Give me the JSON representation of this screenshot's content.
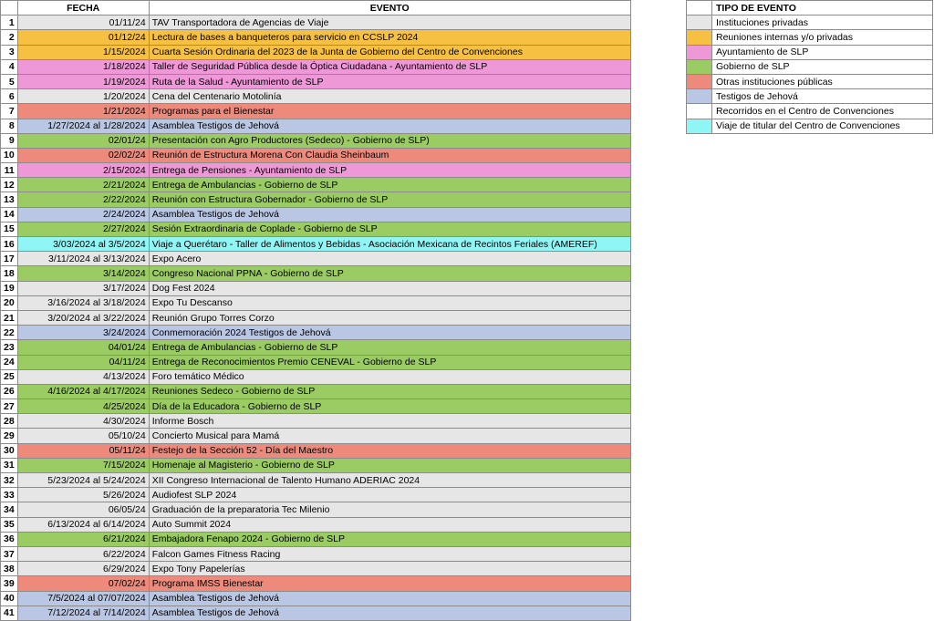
{
  "headers": {
    "fecha": "FECHA",
    "evento": "EVENTO",
    "tipo": "TIPO DE EVENTO"
  },
  "colors": {
    "privadas": "#e6e6e6",
    "internas": "#f6c142",
    "ayuntamiento": "#ef98d7",
    "gobierno": "#9bcc64",
    "otras": "#ee8a7c",
    "testigos": "#b9c6e4",
    "recorridos": "#ffffff",
    "viaje": "#8ff5f5"
  },
  "legend": [
    {
      "label": "Instituciones privadas",
      "type": "privadas"
    },
    {
      "label": "Reuniones internas y/o privadas",
      "type": "internas"
    },
    {
      "label": "Ayuntamiento de SLP",
      "type": "ayuntamiento"
    },
    {
      "label": "Gobierno de SLP",
      "type": "gobierno"
    },
    {
      "label": "Otras instituciones públicas",
      "type": "otras"
    },
    {
      "label": "Testigos de Jehová",
      "type": "testigos"
    },
    {
      "label": "Recorridos en el Centro de Convenciones",
      "type": "recorridos"
    },
    {
      "label": "Viaje de titular del Centro de Convenciones",
      "type": "viaje"
    }
  ],
  "rows": [
    {
      "num": "1",
      "fecha": "01/11/24",
      "evento": "TAV Transportadora de Agencias de Viaje",
      "type": "privadas"
    },
    {
      "num": "2",
      "fecha": "01/12/24",
      "evento": "Lectura de bases a banqueteros para servicio en CCSLP 2024",
      "type": "internas"
    },
    {
      "num": "3",
      "fecha": "1/15/2024",
      "evento": " Cuarta Sesión Ordinaria del 2023 de la Junta de Gobierno del Centro de Convenciones",
      "type": "internas"
    },
    {
      "num": "4",
      "fecha": "1/18/2024",
      "evento": "Taller de Seguridad Pública desde la Óptica Ciudadana - Ayuntamiento de SLP",
      "type": "ayuntamiento"
    },
    {
      "num": "5",
      "fecha": "1/19/2024",
      "evento": "Ruta de la Salud - Ayuntamiento de SLP",
      "type": "ayuntamiento"
    },
    {
      "num": "6",
      "fecha": "1/20/2024",
      "evento": "Cena del Centenario Motolinía",
      "type": "privadas"
    },
    {
      "num": "7",
      "fecha": "1/21/2024",
      "evento": "Programas para el Bienestar",
      "type": "otras"
    },
    {
      "num": "8",
      "fecha": "1/27/2024 al 1/28/2024",
      "evento": "Asamblea Testigos de Jehová",
      "type": "testigos"
    },
    {
      "num": "9",
      "fecha": "02/01/24",
      "evento": "Presentación con Agro Productores (Sedeco) - Gobierno de SLP)",
      "type": "gobierno"
    },
    {
      "num": "10",
      "fecha": "02/02/24",
      "evento": "Reunión de Estructura Morena Con Claudia Sheinbaum",
      "type": "otras"
    },
    {
      "num": "11",
      "fecha": "2/15/2024",
      "evento": "Entrega de Pensiones - Ayuntamiento de SLP",
      "type": "ayuntamiento"
    },
    {
      "num": "12",
      "fecha": "2/21/2024",
      "evento": "Entrega de Ambulancias - Gobierno de SLP",
      "type": "gobierno"
    },
    {
      "num": "13",
      "fecha": "2/22/2024",
      "evento": "Reunión con Estructura Gobernador - Gobierno de SLP",
      "type": "gobierno"
    },
    {
      "num": "14",
      "fecha": "2/24/2024",
      "evento": "Asamblea Testigos de Jehová",
      "type": "testigos"
    },
    {
      "num": "15",
      "fecha": "2/27/2024",
      "evento": "Sesión Extraordinaria de Coplade - Gobierno de SLP",
      "type": "gobierno"
    },
    {
      "num": "16",
      "fecha": "3/03/2024 al 3/5/2024",
      "evento": "Viaje a Querétaro - Taller de Alimentos y Bebidas - Asociación Mexicana de Recintos Feriales (AMEREF)",
      "type": "viaje"
    },
    {
      "num": "17",
      "fecha": "3/11/2024 al 3/13/2024",
      "evento": "Expo Acero",
      "type": "privadas"
    },
    {
      "num": "18",
      "fecha": "3/14/2024",
      "evento": "Congreso Nacional PPNA - Gobierno de SLP",
      "type": "gobierno"
    },
    {
      "num": "19",
      "fecha": "3/17/2024",
      "evento": "Dog Fest 2024",
      "type": "privadas"
    },
    {
      "num": "20",
      "fecha": "3/16/2024 al 3/18/2024",
      "evento": "Expo Tu Descanso",
      "type": "privadas"
    },
    {
      "num": "21",
      "fecha": "3/20/2024 al 3/22/2024",
      "evento": "Reunión Grupo Torres Corzo",
      "type": "privadas"
    },
    {
      "num": "22",
      "fecha": "3/24/2024",
      "evento": "Conmemoración 2024 Testigos de Jehová",
      "type": "testigos"
    },
    {
      "num": "23",
      "fecha": "04/01/24",
      "evento": "Entrega de Ambulancias - Gobierno de SLP",
      "type": "gobierno"
    },
    {
      "num": "24",
      "fecha": "04/11/24",
      "evento": "Entrega de Reconocimientos Premio CENEVAL - Gobierno de SLP",
      "type": "gobierno"
    },
    {
      "num": "25",
      "fecha": "4/13/2024",
      "evento": "Foro temático Médico",
      "type": "privadas"
    },
    {
      "num": "26",
      "fecha": "4/16/2024 al 4/17/2024",
      "evento": "Reuniones Sedeco - Gobierno de SLP",
      "type": "gobierno"
    },
    {
      "num": "27",
      "fecha": "4/25/2024",
      "evento": "Día de la Educadora - Gobierno de SLP",
      "type": "gobierno"
    },
    {
      "num": "28",
      "fecha": "4/30/2024",
      "evento": "Informe Bosch",
      "type": "privadas"
    },
    {
      "num": "29",
      "fecha": "05/10/24",
      "evento": "Concierto Musical para Mamá",
      "type": "privadas"
    },
    {
      "num": "30",
      "fecha": "05/11/24",
      "evento": "Festejo de la Sección 52 - Día del Maestro",
      "type": "otras"
    },
    {
      "num": "31",
      "fecha": "7/15/2024",
      "evento": "Homenaje al Magisterio - Gobierno de SLP",
      "type": "gobierno"
    },
    {
      "num": "32",
      "fecha": "5/23/2024 al 5/24/2024",
      "evento": "XII Congreso Internacional de Talento Humano ADERIAC 2024",
      "type": "privadas"
    },
    {
      "num": "33",
      "fecha": "5/26/2024",
      "evento": "Audiofest SLP 2024",
      "type": "privadas"
    },
    {
      "num": "34",
      "fecha": "06/05/24",
      "evento": "Graduación de la preparatoria Tec Milenio",
      "type": "privadas"
    },
    {
      "num": "35",
      "fecha": "6/13/2024 al 6/14/2024",
      "evento": "Auto Summit 2024",
      "type": "privadas"
    },
    {
      "num": "36",
      "fecha": "6/21/2024",
      "evento": "Embajadora Fenapo 2024 - Gobierno de SLP",
      "type": "gobierno"
    },
    {
      "num": "37",
      "fecha": "6/22/2024",
      "evento": "Falcon Games Fitness Racing",
      "type": "privadas"
    },
    {
      "num": "38",
      "fecha": "6/29/2024",
      "evento": "Expo Tony Papelerías",
      "type": "privadas"
    },
    {
      "num": "39",
      "fecha": "07/02/24",
      "evento": "Programa IMSS Bienestar",
      "type": "otras"
    },
    {
      "num": "40",
      "fecha": "7/5/2024 al 07/07/2024",
      "evento": "Asamblea Testigos de Jehová",
      "type": "testigos"
    },
    {
      "num": "41",
      "fecha": "7/12/2024 al 7/14/2024",
      "evento": "Asamblea Testigos de Jehová",
      "type": "testigos"
    }
  ]
}
